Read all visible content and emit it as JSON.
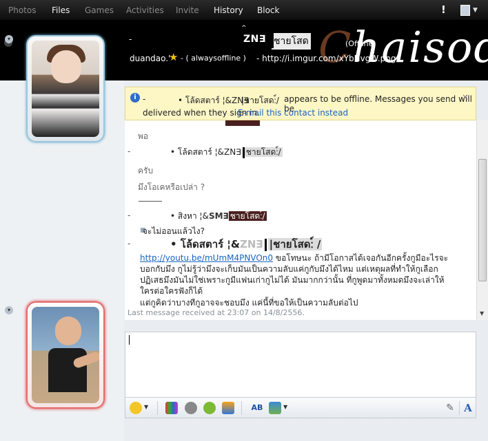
{
  "menubar": {
    "items": [
      "Photos",
      "Files",
      "Games",
      "Activities",
      "Invite",
      "History",
      "Block"
    ],
    "alert": "!"
  },
  "header": {
    "dash": "-",
    "contact_name": "ZN∃",
    "chaisod_text": "ชายโสด",
    "offline": "(Offline)",
    "nick": "duandao.'",
    "status": "- ( alwaysoffline )",
    "url": "-    http://i.imgur.com/xYbNvgW.png",
    "script_prefix": "C",
    "script_rest": "haisod"
  },
  "infobar": {
    "dash": "-",
    "name": "• โล้ดสตาร์ ¦&ZN∃",
    "tag": "|ชายโสด:์/",
    "message": "appears to be offline. Messages you send will be",
    "message2": "delivered when they sign in.",
    "link": "E-mail this contact instead",
    "close": "×"
  },
  "history": {
    "line_po": "พอ",
    "sender1_dash": "-",
    "sender1_name": "• โล้ดสตาร์ ¦&ZN∃",
    "sender1_tag": "ชายโสด:์/",
    "msg_krub": "ครับ",
    "msg_question": "มึงโอเคหรือเปล่า ?",
    "sender2_dash": "-",
    "sender2_name": "• สิงหา ¦&",
    "sender2_sm": "SM∃",
    "sender2_tag": "ชายโสด:์/",
    "msg_online": "จะไม่ออนแล้วไง?",
    "sender3_dash": "-",
    "sender3_name": "• โล้ดสตาร์ ¦&",
    "sender3_zn": "ZN∃",
    "sender3_tag": "|ชายโสด:์ /",
    "youtube": "http://youtu.be/mUmM4PNVOn0",
    "msg_long": "ขอโทษนะ ถ้ามีโอกาสได้เจอกันอีกครั้งกูมีอะไรจะบอกกับมึง กูไม่รู้ว่ามึงจะเก็บมันเป็นความลับแค่กูกับมึงได้ไหม แต่เหตุผลที่ทำให้กูเลือกปฏิเสธมึงมันไม่ใช่เพราะกูมีแฟนเก่ากูไม่ได้ มันมากกว่านั้น ที่กูพูดมาทั้งหมดมึงจะเล่าให้ใครต่อใครฟังก็ได้",
    "msg_last": "แต่กูคิดว่าบางทีกูอาจจะชอบมึง แค่นี้ที่ขอให้เป็นความลับต่อไป",
    "last_received": "Last message received at 23:07 on 14/8/2556."
  },
  "toolbar": {
    "icons": [
      "emoticon-icon",
      "wink-icon",
      "nudge-icon",
      "voice-clip-icon",
      "games-icon",
      "font-icon",
      "background-icon",
      "handwriting-icon",
      "text-format-icon"
    ]
  },
  "colors": {
    "banner_bg": "#000000",
    "infobar_bg": "#fdf7c6",
    "link": "#1a63c2",
    "contact_frame": "#9ac5db",
    "self_frame": "#e56a6a"
  }
}
